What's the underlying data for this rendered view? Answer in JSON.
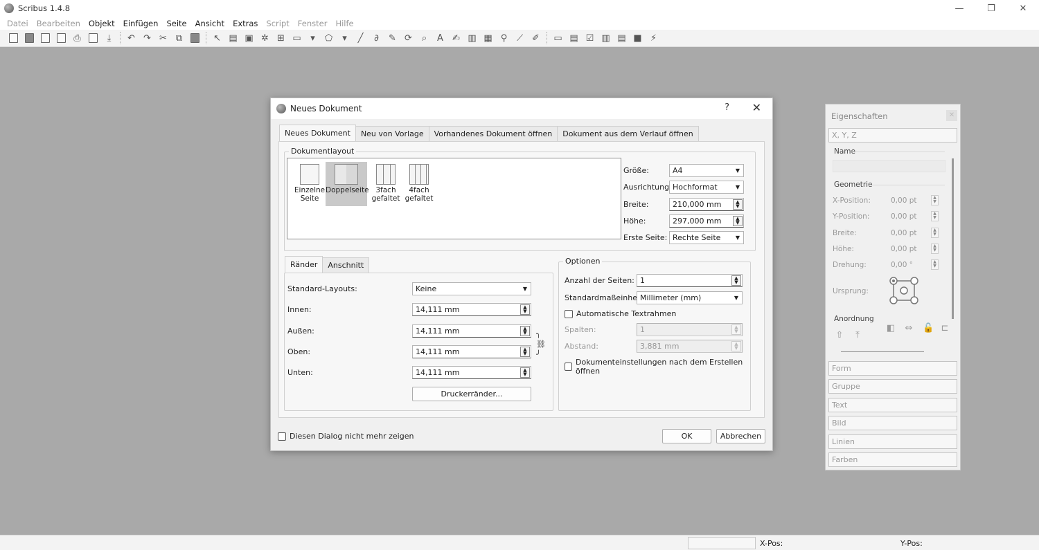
{
  "app": {
    "title": "Scribus 1.4.8"
  },
  "menu": [
    "Datei",
    "Bearbeiten",
    "Objekt",
    "Einfügen",
    "Seite",
    "Ansicht",
    "Extras",
    "Script",
    "Fenster",
    "Hilfe"
  ],
  "window_controls": {
    "minimize": "—",
    "restore": "❐",
    "close": "✕"
  },
  "dialog": {
    "title": "Neues Dokument",
    "help": "?",
    "close": "✕",
    "tabs": [
      "Neues Dokument",
      "Neu von Vorlage",
      "Vorhandenes Dokument öffnen",
      "Dokument aus dem Verlauf öffnen"
    ],
    "layout_group": "Dokumentlayout",
    "layouts": [
      {
        "line1": "Einzelne",
        "line2": "Seite"
      },
      {
        "line1": "Doppelseite",
        "line2": ""
      },
      {
        "line1": "3fach",
        "line2": "gefaltet"
      },
      {
        "line1": "4fach",
        "line2": "gefaltet"
      }
    ],
    "size_label": "Größe:",
    "size_value": "A4",
    "orientation_label": "Ausrichtung:",
    "orientation_value": "Hochformat",
    "width_label": "Breite:",
    "width_value": "210,000 mm",
    "height_label": "Höhe:",
    "height_value": "297,000 mm",
    "first_page_label": "Erste Seite:",
    "first_page_value": "Rechte Seite",
    "sub_tabs": [
      "Ränder",
      "Anschnitt"
    ],
    "std_layouts_label": "Standard-Layouts:",
    "std_layouts_value": "Keine",
    "inner_label": "Innen:",
    "inner_value": "14,111 mm",
    "outer_label": "Außen:",
    "outer_value": "14,111 mm",
    "top_label": "Oben:",
    "top_value": "14,111 mm",
    "bottom_label": "Unten:",
    "bottom_value": "14,111 mm",
    "printer_margins_btn": "Druckerränder...",
    "options_group": "Optionen",
    "pages_label": "Anzahl der Seiten:",
    "pages_value": "1",
    "unit_label": "Standardmaßeinheit:",
    "unit_value": "Millimeter (mm)",
    "auto_frames_label": "Automatische Textrahmen",
    "columns_label": "Spalten:",
    "columns_value": "1",
    "gap_label": "Abstand:",
    "gap_value": "3,881 mm",
    "open_settings_label": "Dokumenteinstellungen nach dem Erstellen öffnen",
    "dont_show_label": "Diesen Dialog nicht mehr zeigen",
    "ok": "OK",
    "cancel": "Abbrechen"
  },
  "properties": {
    "title": "Eigenschaften",
    "xyz": "X, Y, Z",
    "name": "Name",
    "geometry": "Geometrie",
    "xpos_label": "X-Position:",
    "xpos_value": "0,00 pt",
    "ypos_label": "Y-Position:",
    "ypos_value": "0,00 pt",
    "width_label": "Breite:",
    "width_value": "0,00 pt",
    "height_label": "Höhe:",
    "height_value": "0,00 pt",
    "rotation_label": "Drehung:",
    "rotation_value": "0,00 °",
    "origin_label": "Ursprung:",
    "arrangement": "Anordnung",
    "sections": [
      "Form",
      "Gruppe",
      "Text",
      "Bild",
      "Linien",
      "Farben"
    ]
  },
  "status": {
    "xpos": "X-Pos:",
    "ypos": "Y-Pos:"
  }
}
